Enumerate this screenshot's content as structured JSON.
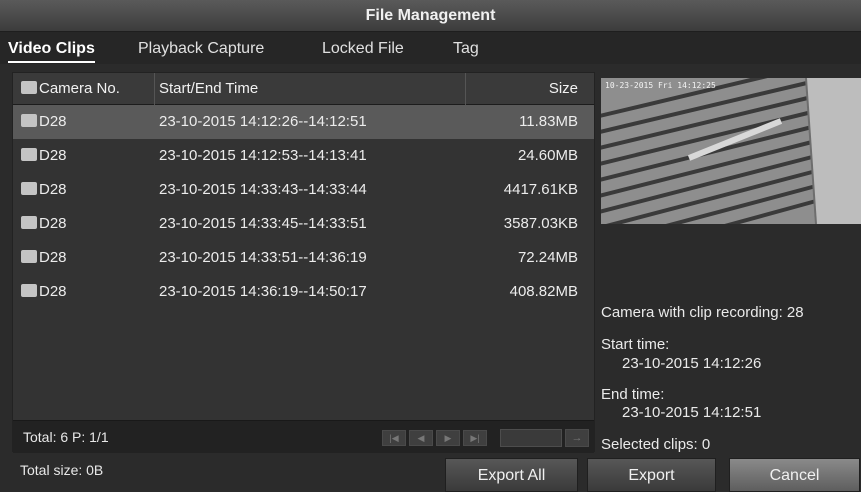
{
  "window": {
    "title": "File Management"
  },
  "tabs": [
    {
      "label": "Video Clips",
      "active": true
    },
    {
      "label": "Playback Capture",
      "active": false
    },
    {
      "label": "Locked File",
      "active": false
    },
    {
      "label": "Tag",
      "active": false
    }
  ],
  "table": {
    "headers": {
      "camera": "Camera No.",
      "time": "Start/End Time",
      "size": "Size"
    },
    "rows": [
      {
        "camera": "D28",
        "time": "23-10-2015 14:12:26--14:12:51",
        "size": "11.83MB",
        "selected": true
      },
      {
        "camera": "D28",
        "time": "23-10-2015 14:12:53--14:13:41",
        "size": "24.60MB",
        "selected": false
      },
      {
        "camera": "D28",
        "time": "23-10-2015 14:33:43--14:33:44",
        "size": "4417.61KB",
        "selected": false
      },
      {
        "camera": "D28",
        "time": "23-10-2015 14:33:45--14:33:51",
        "size": "3587.03KB",
        "selected": false
      },
      {
        "camera": "D28",
        "time": "23-10-2015 14:33:51--14:36:19",
        "size": "72.24MB",
        "selected": false
      },
      {
        "camera": "D28",
        "time": "23-10-2015 14:36:19--14:50:17",
        "size": "408.82MB",
        "selected": false
      }
    ],
    "footer": {
      "total": "Total: 6  P: 1/1"
    }
  },
  "preview": {
    "timestamp": "10-23-2015 Fri 14:12:25"
  },
  "info": {
    "camera_label": "Camera with clip recording: 28",
    "start_label": "Start time:",
    "start_value": "23-10-2015 14:12:26",
    "end_label": "End time:",
    "end_value": "23-10-2015 14:12:51",
    "selected_label": "Selected clips: 0"
  },
  "bottom": {
    "total_size": "Total size: 0B",
    "export_all": "Export All",
    "export": "Export",
    "cancel": "Cancel"
  },
  "icons": {
    "nav": [
      "first-page-icon",
      "prev-page-icon",
      "next-page-icon",
      "last-page-icon",
      "go-icon"
    ]
  },
  "colors": {
    "selected_row": "#5a5a5a",
    "background": "#2b2b2b"
  }
}
